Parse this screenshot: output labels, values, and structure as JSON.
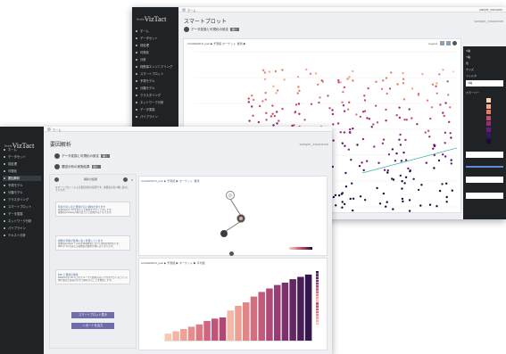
{
  "back_window": {
    "brand_prefix": "Scala",
    "brand_name": "VizTact",
    "topbar_label": "ホーム",
    "topbar_right": "sample_insurance",
    "page_title": "スマートプロット",
    "dataset_name": "sample_insurance",
    "section": {
      "label": "データ変換と可視化の設定",
      "tag": "開く"
    },
    "panel_title": "ACADEMICS_pain ▶ 予測値  ターゲット: 費用 ▶",
    "panel_tools": "Legend",
    "right_panel": {
      "rows": [
        "X軸",
        "Y軸",
        "色",
        "サイズ",
        "フィルタ"
      ],
      "x_value": "X軸",
      "legend_heading": "カラーバー"
    },
    "nav_items": [
      "ホーム",
      "データセット",
      "前処理",
      "可視化",
      "分析",
      "特徴量エンジニアリング",
      "スマートプロット",
      "予測モデル",
      "分類モデル",
      "クラスタリング",
      "ネットワーク分析",
      "データ変換",
      "パイプライン"
    ],
    "scatter_colors": [
      "#1a0a3a",
      "#3b1264",
      "#6a1b7a",
      "#9c2a7a",
      "#c94c6a",
      "#e77a6a",
      "#f4a98a",
      "#fbd3b8"
    ]
  },
  "front_window": {
    "brand_prefix": "Scala",
    "brand_name": "VizTact",
    "topbar_label": "ホーム",
    "page_title": "要因解析",
    "dataset_name": "sample_insurance",
    "section1": {
      "label": "データ変換と可視化の設定",
      "tag": "開く"
    },
    "section2": {
      "label": "要因分析の実施結果",
      "tag": "開く"
    },
    "analysis_panel": {
      "title": "解析の結果",
      "intro": "スマートプロットによる要因分析の結果です。重要度の高い順に表示しています。",
      "cards": [
        {
          "head": "年齢が高いほど費用が高い傾向があります",
          "lines": [
            "年齢(age)が 40 を超えると費用が大きく上昇します。",
            "喫煙者(smoker)の場合はさらに費用が高くなります。"
          ]
        },
        {
          "head": "喫煙の有無が費用に強く影響しています",
          "lines": [
            "喫煙者(smoker = yes)は非喫煙者に比べて費用が約3倍です。",
            "BMI が 30 を超える喫煙者の費用が特に高くなります。"
          ]
        },
        {
          "head": "BMI と費用の関係",
          "lines": [
            "BMI(bmi)が 30 以上のグループで費用のばらつきが大きくなっています。",
            "他の要因と組み合わせて解析することを推奨します。"
          ]
        }
      ],
      "buttons": [
        "スマートプロット表示",
        "レポートを出力"
      ]
    },
    "tree_panel": {
      "title": "ACADEMICS_pain ▶ 予測値 ▶ ターゲット: 費用"
    },
    "chart_panel": {
      "title": "ACADEMICS_pain ▶ 予測値 ▶ ターゲット ▶ 平均値"
    },
    "nav_items": [
      "ホーム",
      "データセット",
      "前処理",
      "可視化",
      "要因解析",
      "予測モデル",
      "分類モデル",
      "クラスタリング",
      "スマートプロット",
      "データ変換",
      "ネットワーク分析",
      "パイプライン",
      "テキスト分析"
    ],
    "active_nav_index": 4
  },
  "chart_data": {
    "type": "bar",
    "categories": [
      "1",
      "2",
      "3",
      "4",
      "5",
      "6",
      "7",
      "8",
      "9",
      "10",
      "11",
      "12",
      "13",
      "14",
      "15",
      "16",
      "17",
      "18",
      "19"
    ],
    "values": [
      6,
      8,
      10,
      12,
      14,
      17,
      19,
      20,
      26,
      30,
      33,
      38,
      42,
      45,
      48,
      50,
      53,
      55,
      57
    ],
    "colors": [
      "#f6c8b0",
      "#f4b5a2",
      "#eea196",
      "#e68c8c",
      "#dd7885",
      "#d1657f",
      "#c35479",
      "#b24673",
      "#f1b9a4",
      "#ec9f92",
      "#e28586",
      "#d36d80",
      "#c25a7c",
      "#ae4a78",
      "#963d73",
      "#7c316c",
      "#632764",
      "#4a1d5a",
      "#33164d"
    ],
    "ylim": [
      0,
      60
    ]
  }
}
